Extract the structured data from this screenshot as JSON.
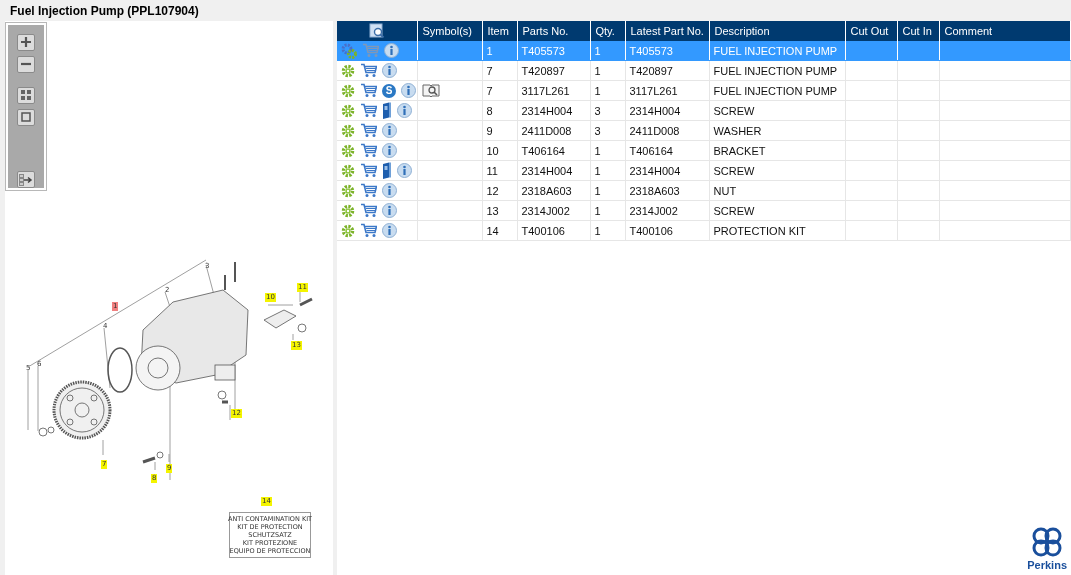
{
  "window": {
    "title": "Fuel Injection Pump (PPL107904)"
  },
  "diagram": {
    "callouts": [
      {
        "label": "1",
        "kind": "selected"
      },
      {
        "label": "2",
        "kind": "plain"
      },
      {
        "label": "3",
        "kind": "plain"
      },
      {
        "label": "4",
        "kind": "plain"
      },
      {
        "label": "5",
        "kind": "plain"
      },
      {
        "label": "6",
        "kind": "plain"
      },
      {
        "label": "7",
        "kind": "hotspot"
      },
      {
        "label": "8",
        "kind": "hotspot"
      },
      {
        "label": "9",
        "kind": "hotspot"
      },
      {
        "label": "10",
        "kind": "hotspot"
      },
      {
        "label": "11",
        "kind": "hotspot"
      },
      {
        "label": "12",
        "kind": "hotspot"
      },
      {
        "label": "13",
        "kind": "hotspot"
      },
      {
        "label": "14",
        "kind": "hotspot"
      }
    ],
    "kit_label": [
      "ANTI CONTAMINATION KIT",
      "KIT DE PROTECTION",
      "SCHUTZSATZ",
      "KIT PROTEZIONE",
      "EQUIPO DE PROTECCION"
    ]
  },
  "table": {
    "columns": [
      "Symbol(s)",
      "Item",
      "Parts No.",
      "Qty.",
      "Latest Part No.",
      "Description",
      "Cut Out",
      "Cut In",
      "Comment"
    ],
    "rows": [
      {
        "selected": true,
        "icons": [
          {
            "kind": "gears"
          },
          {
            "kind": "cart"
          },
          {
            "kind": "info"
          }
        ],
        "item": "1",
        "part": "T405573",
        "qty": "1",
        "latest": "T405573",
        "description": "FUEL INJECTION PUMP"
      },
      {
        "selected": false,
        "icons": [
          {
            "kind": "gear"
          },
          {
            "kind": "cart"
          },
          {
            "kind": "info"
          }
        ],
        "item": "7",
        "part": "T420897",
        "qty": "1",
        "latest": "T420897",
        "description": "FUEL INJECTION PUMP"
      },
      {
        "selected": false,
        "icons": [
          {
            "kind": "gear"
          },
          {
            "kind": "cart"
          },
          {
            "kind": "badge",
            "text": "S"
          },
          {
            "kind": "info"
          }
        ],
        "symbols": [
          {
            "kind": "book-search"
          }
        ],
        "item": "7",
        "part": "3117L261",
        "qty": "1",
        "latest": "3117L261",
        "description": "FUEL INJECTION PUMP"
      },
      {
        "selected": false,
        "icons": [
          {
            "kind": "gear"
          },
          {
            "kind": "cart"
          },
          {
            "kind": "book"
          },
          {
            "kind": "info"
          }
        ],
        "item": "8",
        "part": "2314H004",
        "qty": "3",
        "latest": "2314H004",
        "description": "SCREW"
      },
      {
        "selected": false,
        "icons": [
          {
            "kind": "gear"
          },
          {
            "kind": "cart"
          },
          {
            "kind": "info"
          }
        ],
        "item": "9",
        "part": "2411D008",
        "qty": "3",
        "latest": "2411D008",
        "description": "WASHER"
      },
      {
        "selected": false,
        "icons": [
          {
            "kind": "gear"
          },
          {
            "kind": "cart"
          },
          {
            "kind": "info"
          }
        ],
        "item": "10",
        "part": "T406164",
        "qty": "1",
        "latest": "T406164",
        "description": "BRACKET"
      },
      {
        "selected": false,
        "icons": [
          {
            "kind": "gear"
          },
          {
            "kind": "cart"
          },
          {
            "kind": "book"
          },
          {
            "kind": "info"
          }
        ],
        "item": "11",
        "part": "2314H004",
        "qty": "1",
        "latest": "2314H004",
        "description": "SCREW"
      },
      {
        "selected": false,
        "icons": [
          {
            "kind": "gear"
          },
          {
            "kind": "cart"
          },
          {
            "kind": "info"
          }
        ],
        "item": "12",
        "part": "2318A603",
        "qty": "1",
        "latest": "2318A603",
        "description": "NUT"
      },
      {
        "selected": false,
        "icons": [
          {
            "kind": "gear"
          },
          {
            "kind": "cart"
          },
          {
            "kind": "info"
          }
        ],
        "item": "13",
        "part": "2314J002",
        "qty": "1",
        "latest": "2314J002",
        "description": "SCREW"
      },
      {
        "selected": false,
        "icons": [
          {
            "kind": "gear"
          },
          {
            "kind": "cart"
          },
          {
            "kind": "info"
          }
        ],
        "item": "14",
        "part": "T400106",
        "qty": "1",
        "latest": "T400106",
        "description": "PROTECTION KIT"
      }
    ]
  },
  "logo": {
    "text": "Perkins"
  }
}
